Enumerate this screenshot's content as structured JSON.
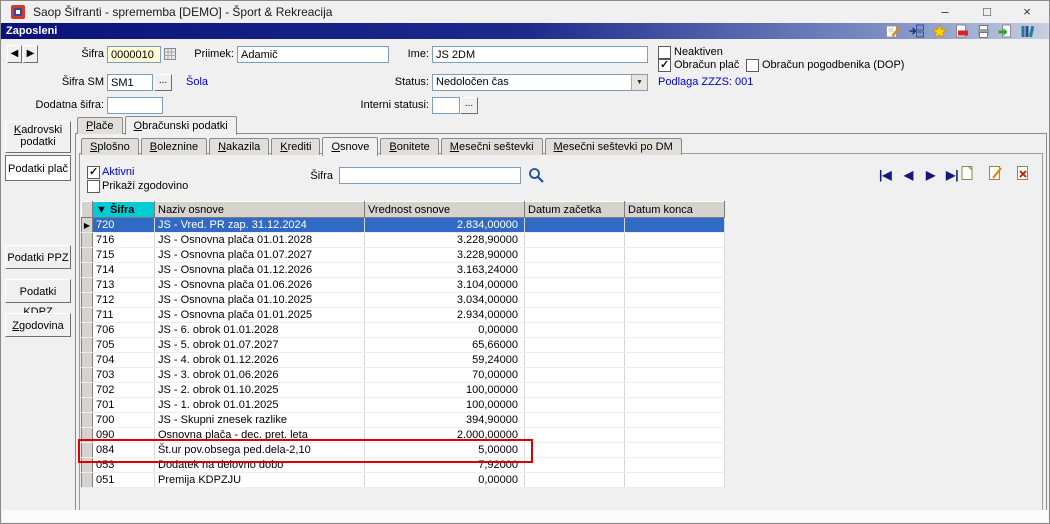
{
  "window": {
    "title": "Saop Šifranti - sprememba [DEMO] - Šport & Rekreacija",
    "controls": {
      "minimize": "–",
      "maximize": "□",
      "close": "×"
    }
  },
  "appbar": {
    "title": "Zaposleni",
    "icons": [
      "edit",
      "export-grid",
      "favorite-star",
      "pdf-export",
      "print",
      "document-export",
      "library-books"
    ]
  },
  "form": {
    "nav_prev": "◀",
    "nav_next": "▶",
    "sifra": {
      "label": "Šifra",
      "value": "0000010"
    },
    "priimek": {
      "label": "Priimek:",
      "value": "Adamič"
    },
    "ime": {
      "label": "Ime:",
      "value": "JS 2DM"
    },
    "neaktiven": {
      "label": "Neaktiven",
      "checked": false
    },
    "obracun_plac": {
      "label": "Obračun plač",
      "checked": true
    },
    "obracun_pogodbenika": {
      "label": "Obračun pogodbenika (DOP)",
      "checked": false
    },
    "sifra_sm": {
      "label": "Šifra SM",
      "value": "SM1",
      "browse": "...",
      "link": "Šola"
    },
    "status": {
      "label": "Status:",
      "value": "Nedoločen čas"
    },
    "podlaga": "Podlaga ZZZS: 001",
    "dodatna_sifra": {
      "label": "Dodatna šifra:",
      "value": ""
    },
    "interni_statusi": {
      "label": "Interni statusi:",
      "value": "",
      "browse": "..."
    }
  },
  "sidebar": {
    "items": [
      "Kadrovski podatki",
      "Podatki plač",
      "Podatki PPZ",
      "Podatki KDPZ",
      "Zgodovina"
    ],
    "active": "Podatki plač"
  },
  "tabs": {
    "main": [
      "Plače",
      "Obračunski podatki"
    ],
    "main_selected": "Obračunski podatki",
    "sub": [
      "Splošno",
      "Boleznine",
      "Nakazila",
      "Krediti",
      "Osnove",
      "Bonitete",
      "Mesečni seštevki",
      "Mesečni seštevki po DM"
    ],
    "sub_selected": "Osnove"
  },
  "filter": {
    "aktivni": {
      "label": "Aktivni",
      "checked": true
    },
    "prikazi": {
      "label": "Prikaži zgodovino",
      "checked": false
    },
    "sifra_label": "Šifra",
    "search_value": ""
  },
  "grid_nav": {
    "first": "|◀",
    "prev": "◀",
    "next": "▶",
    "last": "▶|"
  },
  "table": {
    "sort_indicator": "▼",
    "row_marker": "▶",
    "columns": [
      "Šifra",
      "Naziv osnove",
      "Vrednost osnove",
      "Datum začetka",
      "Datum konca"
    ],
    "rows": [
      {
        "sifra": "720",
        "naziv": "JS - Vred. PR zap. 31.12.2024",
        "vrednost": "2.834,00000",
        "selected": true
      },
      {
        "sifra": "716",
        "naziv": "JS - Osnovna plača 01.01.2028",
        "vrednost": "3.228,90000"
      },
      {
        "sifra": "715",
        "naziv": "JS - Osnovna plača 01.07.2027",
        "vrednost": "3.228,90000"
      },
      {
        "sifra": "714",
        "naziv": "JS - Osnovna plača 01.12.2026",
        "vrednost": "3.163,24000"
      },
      {
        "sifra": "713",
        "naziv": "JS - Osnovna plača 01.06.2026",
        "vrednost": "3.104,00000"
      },
      {
        "sifra": "712",
        "naziv": "JS - Osnovna plača 01.10.2025",
        "vrednost": "3.034,00000"
      },
      {
        "sifra": "711",
        "naziv": "JS - Osnovna plača 01.01.2025",
        "vrednost": "2.934,00000"
      },
      {
        "sifra": "706",
        "naziv": "JS - 6. obrok 01.01.2028",
        "vrednost": "0,00000"
      },
      {
        "sifra": "705",
        "naziv": "JS - 5. obrok 01.07.2027",
        "vrednost": "65,66000"
      },
      {
        "sifra": "704",
        "naziv": "JS - 4. obrok 01.12.2026",
        "vrednost": "59,24000"
      },
      {
        "sifra": "703",
        "naziv": "JS - 3. obrok 01.06.2026",
        "vrednost": "70,00000"
      },
      {
        "sifra": "702",
        "naziv": "JS - 2. obrok 01.10.2025",
        "vrednost": "100,00000"
      },
      {
        "sifra": "701",
        "naziv": "JS - 1. obrok 01.01.2025",
        "vrednost": "100,00000"
      },
      {
        "sifra": "700",
        "naziv": "JS - Skupni znesek razlike",
        "vrednost": "394,90000"
      },
      {
        "sifra": "090",
        "naziv": "Osnovna plača - dec. pret. leta",
        "vrednost": "2.000,00000"
      },
      {
        "sifra": "084",
        "naziv": "Št.ur pov.obsega ped.dela-2,10",
        "vrednost": "5,00000",
        "highlighted": true
      },
      {
        "sifra": "053",
        "naziv": "Dodatek na delovno dobo",
        "vrednost": "7,92000"
      },
      {
        "sifra": "051",
        "naziv": "Premija KDPZJU",
        "vrednost": "0,00000"
      }
    ]
  },
  "annotation": {
    "highlighted_row": "084",
    "highlight_color": "#dd0000"
  },
  "colors": {
    "selection": "#316ac5",
    "sifra_header": "#00ccd5",
    "link": "#0000cc"
  }
}
